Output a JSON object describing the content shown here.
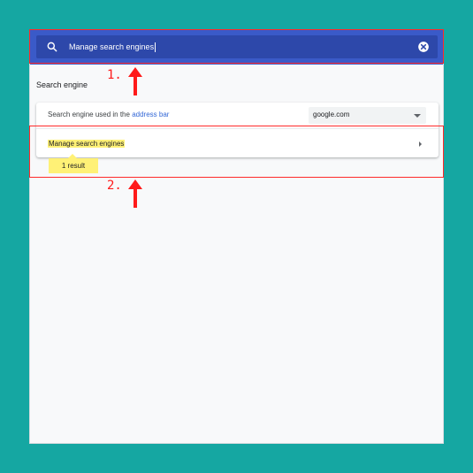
{
  "search": {
    "value": "Manage search engines"
  },
  "section": {
    "title": "Search engine"
  },
  "settings": {
    "row1": {
      "label_prefix": "Search engine used in the",
      "link": "address bar",
      "dropdown_value": "google.com"
    },
    "row2": {
      "label": "Manage search engines"
    },
    "result_badge": "1 result"
  },
  "annotations": {
    "label1": "1.",
    "label2": "2."
  },
  "colors": {
    "background": "#15a7a2",
    "topbar": "#3a5ac8",
    "highlight": "#fff176",
    "annotation": "#ff1a1a",
    "link": "#3367d6"
  }
}
